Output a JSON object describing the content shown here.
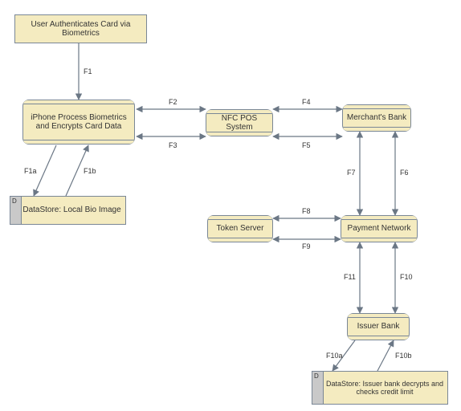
{
  "nodes": {
    "user_auth": {
      "label": "User Authenticates Card via Biometrics"
    },
    "iphone": {
      "label": "iPhone Process Biometrics and Encrypts Card Data"
    },
    "local_bio": {
      "label": "DataStore: Local Bio Image",
      "d": "D"
    },
    "nfc_pos": {
      "label": "NFC POS System"
    },
    "merch_bank": {
      "label": "Merchant's Bank"
    },
    "token_srv": {
      "label": "Token Server"
    },
    "pay_net": {
      "label": "Payment Network"
    },
    "issuer": {
      "label": "Issuer Bank"
    },
    "issuer_ds": {
      "label": "DataStore: Issuer bank decrypts and checks credit limit",
      "d": "D"
    }
  },
  "edges": {
    "f1": "F1",
    "f1a": "F1a",
    "f1b": "F1b",
    "f2": "F2",
    "f3": "F3",
    "f4": "F4",
    "f5": "F5",
    "f6": "F6",
    "f7": "F7",
    "f8": "F8",
    "f9": "F9",
    "f10": "F10",
    "f10a": "F10a",
    "f10b": "F10b",
    "f11": "F11"
  },
  "chart_data": {
    "type": "diagram",
    "title": "",
    "diagram_type": "data-flow-diagram",
    "nodes": [
      {
        "id": "user_auth",
        "label": "User Authenticates Card via Biometrics",
        "kind": "external-entity"
      },
      {
        "id": "iphone",
        "label": "iPhone Process Biometrics and Encrypts Card Data",
        "kind": "process"
      },
      {
        "id": "local_bio",
        "label": "DataStore: Local Bio Image",
        "kind": "datastore"
      },
      {
        "id": "nfc_pos",
        "label": "NFC POS System",
        "kind": "process"
      },
      {
        "id": "merch_bank",
        "label": "Merchant's Bank",
        "kind": "process"
      },
      {
        "id": "token_srv",
        "label": "Token Server",
        "kind": "process"
      },
      {
        "id": "pay_net",
        "label": "Payment Network",
        "kind": "process"
      },
      {
        "id": "issuer",
        "label": "Issuer Bank",
        "kind": "process"
      },
      {
        "id": "issuer_ds",
        "label": "DataStore: Issuer bank decrypts and checks credit limit",
        "kind": "datastore"
      }
    ],
    "edges": [
      {
        "id": "F1",
        "from": "user_auth",
        "to": "iphone",
        "direction": "one-way"
      },
      {
        "id": "F1a",
        "from": "iphone",
        "to": "local_bio",
        "direction": "one-way"
      },
      {
        "id": "F1b",
        "from": "local_bio",
        "to": "iphone",
        "direction": "one-way"
      },
      {
        "id": "F2",
        "from": "iphone",
        "to": "nfc_pos",
        "direction": "two-way"
      },
      {
        "id": "F3",
        "from": "nfc_pos",
        "to": "iphone",
        "direction": "two-way"
      },
      {
        "id": "F4",
        "from": "nfc_pos",
        "to": "merch_bank",
        "direction": "two-way"
      },
      {
        "id": "F5",
        "from": "merch_bank",
        "to": "nfc_pos",
        "direction": "two-way"
      },
      {
        "id": "F6",
        "from": "merch_bank",
        "to": "pay_net",
        "direction": "two-way"
      },
      {
        "id": "F7",
        "from": "pay_net",
        "to": "merch_bank",
        "direction": "two-way"
      },
      {
        "id": "F8",
        "from": "pay_net",
        "to": "token_srv",
        "direction": "two-way"
      },
      {
        "id": "F9",
        "from": "token_srv",
        "to": "pay_net",
        "direction": "two-way"
      },
      {
        "id": "F10",
        "from": "pay_net",
        "to": "issuer",
        "direction": "two-way"
      },
      {
        "id": "F11",
        "from": "issuer",
        "to": "pay_net",
        "direction": "two-way"
      },
      {
        "id": "F10a",
        "from": "issuer",
        "to": "issuer_ds",
        "direction": "one-way"
      },
      {
        "id": "F10b",
        "from": "issuer_ds",
        "to": "issuer",
        "direction": "one-way"
      }
    ]
  }
}
